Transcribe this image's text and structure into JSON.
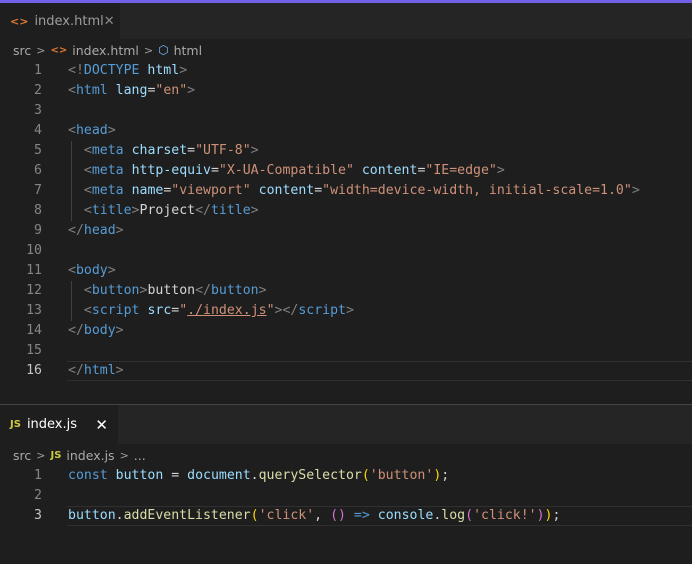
{
  "editor_html": {
    "tab": {
      "icon": "html-file-icon",
      "label": "index.html",
      "close": "✕"
    },
    "breadcrumb": [
      "src",
      "index.html",
      "html"
    ],
    "current_line": "16",
    "lines": [
      {
        "n": "1",
        "t": [
          [
            "tag",
            "<!"
          ],
          [
            "tn",
            "DOCTYPE"
          ],
          [
            "tx",
            " "
          ],
          [
            "an",
            "html"
          ],
          [
            "tag",
            ">"
          ]
        ]
      },
      {
        "n": "2",
        "t": [
          [
            "tag",
            "<"
          ],
          [
            "tn",
            "html"
          ],
          [
            "tx",
            " "
          ],
          [
            "an",
            "lang"
          ],
          [
            "tx",
            "="
          ],
          [
            "av",
            "\"en\""
          ],
          [
            "tag",
            ">"
          ]
        ]
      },
      {
        "n": "3",
        "t": []
      },
      {
        "n": "4",
        "t": [
          [
            "tag",
            "<"
          ],
          [
            "tn",
            "head"
          ],
          [
            "tag",
            ">"
          ]
        ]
      },
      {
        "n": "5",
        "t": [
          [
            "tx",
            "  "
          ],
          [
            "tag",
            "<"
          ],
          [
            "tn",
            "meta"
          ],
          [
            "tx",
            " "
          ],
          [
            "an",
            "charset"
          ],
          [
            "tx",
            "="
          ],
          [
            "av",
            "\"UTF-8\""
          ],
          [
            "tag",
            ">"
          ]
        ]
      },
      {
        "n": "6",
        "t": [
          [
            "tx",
            "  "
          ],
          [
            "tag",
            "<"
          ],
          [
            "tn",
            "meta"
          ],
          [
            "tx",
            " "
          ],
          [
            "an",
            "http-equiv"
          ],
          [
            "tx",
            "="
          ],
          [
            "av",
            "\"X-UA-Compatible\""
          ],
          [
            "tx",
            " "
          ],
          [
            "an",
            "content"
          ],
          [
            "tx",
            "="
          ],
          [
            "av",
            "\"IE=edge\""
          ],
          [
            "tag",
            ">"
          ]
        ]
      },
      {
        "n": "7",
        "t": [
          [
            "tx",
            "  "
          ],
          [
            "tag",
            "<"
          ],
          [
            "tn",
            "meta"
          ],
          [
            "tx",
            " "
          ],
          [
            "an",
            "name"
          ],
          [
            "tx",
            "="
          ],
          [
            "av",
            "\"viewport\""
          ],
          [
            "tx",
            " "
          ],
          [
            "an",
            "content"
          ],
          [
            "tx",
            "="
          ],
          [
            "av",
            "\"width=device-width, initial-scale=1.0\""
          ],
          [
            "tag",
            ">"
          ]
        ]
      },
      {
        "n": "8",
        "t": [
          [
            "tx",
            "  "
          ],
          [
            "tag",
            "<"
          ],
          [
            "tn",
            "title"
          ],
          [
            "tag",
            ">"
          ],
          [
            "tx",
            "Project"
          ],
          [
            "tag",
            "</"
          ],
          [
            "tn",
            "title"
          ],
          [
            "tag",
            ">"
          ]
        ]
      },
      {
        "n": "9",
        "t": [
          [
            "tag",
            "</"
          ],
          [
            "tn",
            "head"
          ],
          [
            "tag",
            ">"
          ]
        ]
      },
      {
        "n": "10",
        "t": []
      },
      {
        "n": "11",
        "t": [
          [
            "tag",
            "<"
          ],
          [
            "tn",
            "body"
          ],
          [
            "tag",
            ">"
          ]
        ]
      },
      {
        "n": "12",
        "t": [
          [
            "tx",
            "  "
          ],
          [
            "tag",
            "<"
          ],
          [
            "tn",
            "button"
          ],
          [
            "tag",
            ">"
          ],
          [
            "tx",
            "button"
          ],
          [
            "tag",
            "</"
          ],
          [
            "tn",
            "button"
          ],
          [
            "tag",
            ">"
          ]
        ]
      },
      {
        "n": "13",
        "t": [
          [
            "tx",
            "  "
          ],
          [
            "tag",
            "<"
          ],
          [
            "tn",
            "script"
          ],
          [
            "tx",
            " "
          ],
          [
            "an",
            "src"
          ],
          [
            "tx",
            "="
          ],
          [
            "av",
            "\""
          ],
          [
            "av ul",
            "./index.js"
          ],
          [
            "av",
            "\""
          ],
          [
            "tag",
            "></"
          ],
          [
            "tn",
            "script"
          ],
          [
            "tag",
            ">"
          ]
        ]
      },
      {
        "n": "14",
        "t": [
          [
            "tag",
            "</"
          ],
          [
            "tn",
            "body"
          ],
          [
            "tag",
            ">"
          ]
        ]
      },
      {
        "n": "15",
        "t": []
      },
      {
        "n": "16",
        "t": [
          [
            "tag",
            "</"
          ],
          [
            "tn",
            "html"
          ],
          [
            "tag",
            ">"
          ]
        ]
      }
    ]
  },
  "editor_js": {
    "tab": {
      "icon": "js-file-icon",
      "label": "index.js",
      "close": "✕"
    },
    "breadcrumb": [
      "src",
      "index.js",
      "..."
    ],
    "current_line": "3",
    "lines": [
      {
        "n": "1",
        "t": [
          [
            "kw",
            "const"
          ],
          [
            "tx",
            " "
          ],
          [
            "vr",
            "button"
          ],
          [
            "tx",
            " = "
          ],
          [
            "vr",
            "document"
          ],
          [
            "tx",
            "."
          ],
          [
            "fn",
            "querySelector"
          ],
          [
            "b1",
            "("
          ],
          [
            "st",
            "'button'"
          ],
          [
            "b1",
            ")"
          ],
          [
            "tx",
            ";"
          ]
        ]
      },
      {
        "n": "2",
        "t": []
      },
      {
        "n": "3",
        "t": [
          [
            "vr",
            "button"
          ],
          [
            "tx",
            "."
          ],
          [
            "fn",
            "addEventListener"
          ],
          [
            "b1",
            "("
          ],
          [
            "st",
            "'click'"
          ],
          [
            "tx",
            ", "
          ],
          [
            "b2",
            "()"
          ],
          [
            "tx",
            " "
          ],
          [
            "kw",
            "=>"
          ],
          [
            "tx",
            " "
          ],
          [
            "vr",
            "console"
          ],
          [
            "tx",
            "."
          ],
          [
            "fn",
            "log"
          ],
          [
            "b2",
            "("
          ],
          [
            "st",
            "'click!'"
          ],
          [
            "b2",
            ")"
          ],
          [
            "b1",
            ")"
          ],
          [
            "tx",
            ";"
          ]
        ]
      }
    ]
  },
  "icons": {
    "chevron": "chevron-right-icon",
    "html": "html-file-icon",
    "js": "js-file-icon",
    "symbol": "cube-icon"
  },
  "icon_glyphs": {
    "html_tab": "<>",
    "js_tab": "JS",
    "symbol": "⬡",
    "chevron": ">"
  }
}
